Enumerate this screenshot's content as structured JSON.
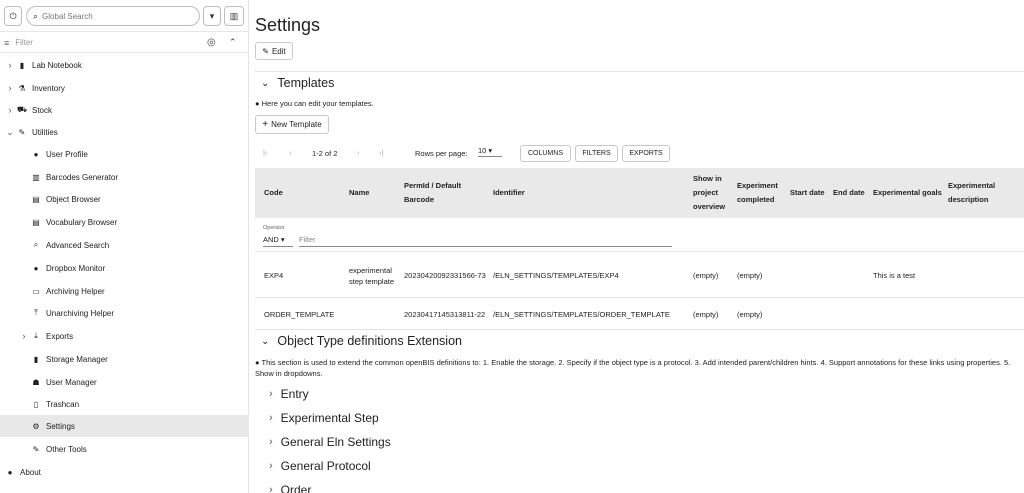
{
  "toolbar": {
    "power_icon": "⏻",
    "search_placeholder": "Global Search",
    "dropdown_icon": "▾",
    "barcode_icon": "▥"
  },
  "sidebar": {
    "filter_placeholder": "Filter",
    "items": [
      {
        "label": "Lab Notebook",
        "icon": "▮",
        "chev": "›"
      },
      {
        "label": "Inventory",
        "icon": "⚗",
        "chev": "›"
      },
      {
        "label": "Stock",
        "icon": "⛟",
        "chev": "›"
      },
      {
        "label": "Utilities",
        "icon": "✎",
        "chev": "⌄"
      },
      {
        "label": "User Profile",
        "icon": "●"
      },
      {
        "label": "Barcodes Generator",
        "icon": "▥"
      },
      {
        "label": "Object Browser",
        "icon": "▤"
      },
      {
        "label": "Vocabulary Browser",
        "icon": "▤"
      },
      {
        "label": "Advanced Search",
        "icon": "⌕"
      },
      {
        "label": "Dropbox Monitor",
        "icon": "●"
      },
      {
        "label": "Archiving Helper",
        "icon": "▭"
      },
      {
        "label": "Unarchiving Helper",
        "icon": "⤒"
      },
      {
        "label": "Exports",
        "icon": "⤓",
        "chev": "›"
      },
      {
        "label": "Storage Manager",
        "icon": "▮"
      },
      {
        "label": "User Manager",
        "icon": "☗"
      },
      {
        "label": "Trashcan",
        "icon": "▯"
      },
      {
        "label": "Settings",
        "icon": "⚙"
      },
      {
        "label": "Other Tools",
        "icon": "✎"
      },
      {
        "label": "About",
        "icon": "●"
      }
    ]
  },
  "main": {
    "title": "Settings",
    "edit_label": "Edit",
    "templates": {
      "heading": "Templates",
      "info": "Here you can edit your templates.",
      "new_template_label": "New Template",
      "pagination": {
        "first": "|‹",
        "prev": "‹",
        "range": "1-2 of 2",
        "next": "›",
        "last": "›|",
        "rows_label": "Rows per page:",
        "rows_value": "10"
      },
      "buttons": [
        "COLUMNS",
        "FILTERS",
        "EXPORTS"
      ],
      "columns": [
        "Code",
        "Name",
        "PermId / Default Barcode",
        "Identifier",
        "Show in project overview",
        "Experiment completed",
        "Start date",
        "End date",
        "Experimental goals",
        "Experimental description"
      ],
      "operator_label": "Operator",
      "operator_value": "AND",
      "filter_placeholder": "Filter",
      "rows": [
        {
          "code": "EXP4",
          "name": "experimental step template",
          "permid": "20230420092331566-73",
          "identifier": "/ELN_SETTINGS/TEMPLATES/EXP4",
          "show": "(empty)",
          "completed": "(empty)",
          "goals": "This is a test"
        },
        {
          "code": "ORDER_TEMPLATE",
          "name": "",
          "permid": "20230417145313811-22",
          "identifier": "/ELN_SETTINGS/TEMPLATES/ORDER_TEMPLATE",
          "show": "(empty)",
          "completed": "(empty)",
          "goals": ""
        }
      ]
    },
    "object_types": {
      "heading": "Object Type definitions Extension",
      "info": "This section is used to extend the common openBIS definitions to: 1. Enable the storage. 2. Specify if the object type is a protocol. 3. Add intended parent/children hints. 4. Support annotations for these links using properties. 5. Show in dropdowns.",
      "sections": [
        "Entry",
        "Experimental Step",
        "General Eln Settings",
        "General Protocol",
        "Order"
      ]
    }
  }
}
